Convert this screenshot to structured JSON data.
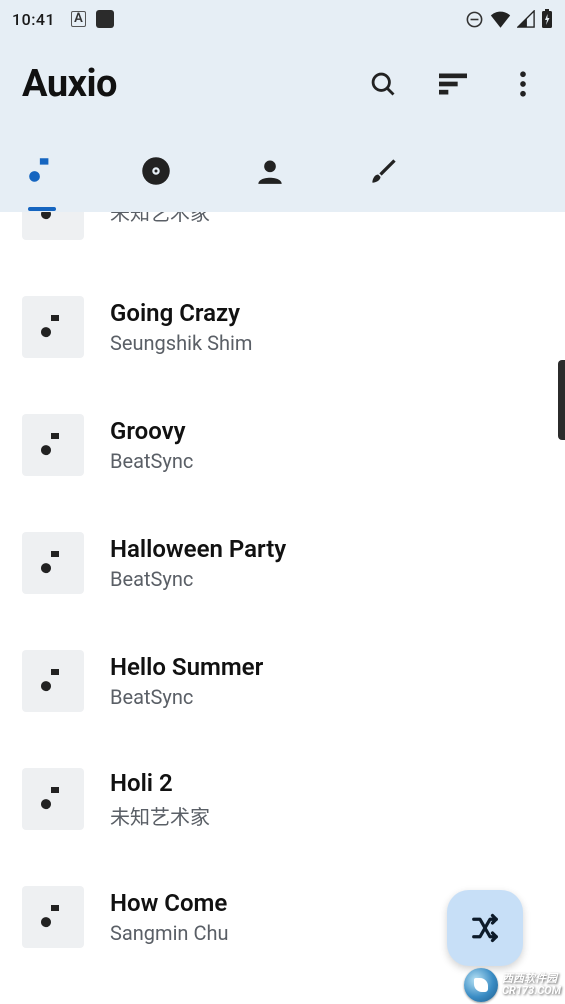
{
  "status": {
    "time": "10:41",
    "a_indicator": "A"
  },
  "app": {
    "title": "Auxio"
  },
  "tabs": [
    {
      "name": "songs",
      "active": true
    },
    {
      "name": "albums",
      "active": false
    },
    {
      "name": "artists",
      "active": false
    },
    {
      "name": "genres",
      "active": false
    }
  ],
  "tracks": [
    {
      "title": "",
      "artist": "未知艺术家",
      "partial": true
    },
    {
      "title": "Going Crazy",
      "artist": "Seungshik Shim",
      "partial": false
    },
    {
      "title": "Groovy",
      "artist": "BeatSync",
      "partial": false
    },
    {
      "title": "Halloween Party",
      "artist": "BeatSync",
      "partial": false
    },
    {
      "title": "Hello Summer",
      "artist": "BeatSync",
      "partial": false
    },
    {
      "title": "Holi 2",
      "artist": "未知艺术家",
      "partial": false
    },
    {
      "title": "How Come",
      "artist": "Sangmin Chu",
      "partial": false
    }
  ],
  "watermark": {
    "line1": "西西软件园",
    "line2": "CR173.COM"
  },
  "colors": {
    "header_bg": "#e6eef5",
    "accent": "#1565c0",
    "fab_bg": "#c7dff7"
  }
}
